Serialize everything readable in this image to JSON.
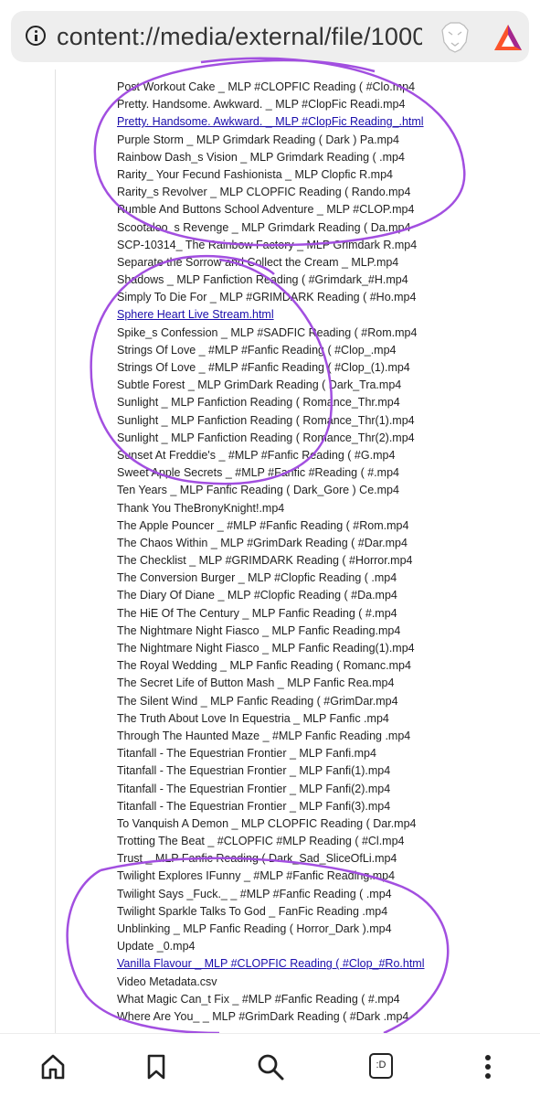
{
  "address_bar": {
    "url": "content://media/external/file/1000",
    "icons": [
      "info-icon",
      "brave-lion-icon",
      "brave-rewards-icon"
    ]
  },
  "colors": {
    "link": "#1a0dab",
    "annotation": "#a24fe0",
    "urlbar_bg": "#eeeeee",
    "brave_orange": "#fb542b"
  },
  "files": [
    {
      "name": "Post Workout Cake _ MLP #CLOPFIC Reading ( #Clo.mp4",
      "link": false
    },
    {
      "name": "Pretty. Handsome. Awkward. _ MLP #ClopFic Readi.mp4",
      "link": false
    },
    {
      "name": "Pretty. Handsome. Awkward. _ MLP #ClopFic Reading_.html",
      "link": true
    },
    {
      "name": "Purple Storm _ MLP Grimdark Reading ( Dark ) Pa.mp4",
      "link": false
    },
    {
      "name": "Rainbow Dash_s Vision _ MLP Grimdark Reading ( .mp4",
      "link": false
    },
    {
      "name": "Rarity_ Your Fecund Fashionista _ MLP Clopfic R.mp4",
      "link": false
    },
    {
      "name": "Rarity_s Revolver _ MLP CLOPFIC Reading ( Rando.mp4",
      "link": false
    },
    {
      "name": "Rumble And Buttons School Adventure _ MLP #CLOP.mp4",
      "link": false
    },
    {
      "name": "Scootaloo_s Revenge _ MLP Grimdark Reading ( Da.mp4",
      "link": false
    },
    {
      "name": "SCP-10314_ The Rainbow Factory _ MLP Grimdark R.mp4",
      "link": false
    },
    {
      "name": "Separate the Sorrow and Collect the Cream _ MLP.mp4",
      "link": false
    },
    {
      "name": "Shadows _ MLP Fanfiction Reading ( #Grimdark_#H.mp4",
      "link": false
    },
    {
      "name": "Simply To Die For _ MLP #GRIMDARK Reading ( #Ho.mp4",
      "link": false
    },
    {
      "name": "Sphere Heart Live Stream.html",
      "link": true
    },
    {
      "name": "Spike_s Confession _ MLP #SADFIC Reading ( #Rom.mp4",
      "link": false
    },
    {
      "name": "Strings Of Love _ #MLP #Fanfic Reading ( #Clop_.mp4",
      "link": false
    },
    {
      "name": "Strings Of Love _ #MLP #Fanfic Reading ( #Clop_(1).mp4",
      "link": false
    },
    {
      "name": "Subtle Forest _ MLP GrimDark Reading ( Dark_Tra.mp4",
      "link": false
    },
    {
      "name": "Sunlight _ MLP Fanfiction Reading ( Romance_Thr.mp4",
      "link": false
    },
    {
      "name": "Sunlight _ MLP Fanfiction Reading ( Romance_Thr(1).mp4",
      "link": false
    },
    {
      "name": "Sunlight _ MLP Fanfiction Reading ( Romance_Thr(2).mp4",
      "link": false
    },
    {
      "name": "Sunset At Freddie's _ #MLP #Fanfic Reading ( #G.mp4",
      "link": false
    },
    {
      "name": "Sweet Apple Secrets _ #MLP #Fanfic #Reading ( #.mp4",
      "link": false
    },
    {
      "name": "Ten Years _ MLP Fanfic Reading ( Dark_Gore ) Ce.mp4",
      "link": false
    },
    {
      "name": "Thank You TheBronyKnight!.mp4",
      "link": false
    },
    {
      "name": "The Apple Pouncer _ #MLP #Fanfic Reading ( #Rom.mp4",
      "link": false
    },
    {
      "name": "The Chaos Within _ MLP #GrimDark Reading ( #Dar.mp4",
      "link": false
    },
    {
      "name": "The Checklist _ MLP #GRIMDARK Reading ( #Horror.mp4",
      "link": false
    },
    {
      "name": "The Conversion Burger _ MLP #Clopfic Reading ( .mp4",
      "link": false
    },
    {
      "name": "The Diary Of Diane _ MLP #Clopfic Reading ( #Da.mp4",
      "link": false
    },
    {
      "name": "The HiE Of The Century _ MLP Fanfic Reading ( #.mp4",
      "link": false
    },
    {
      "name": "The Nightmare Night Fiasco _ MLP Fanfic Reading.mp4",
      "link": false
    },
    {
      "name": "The Nightmare Night Fiasco _ MLP Fanfic Reading(1).mp4",
      "link": false
    },
    {
      "name": "The Royal Wedding _ MLP Fanfic Reading ( Romanc.mp4",
      "link": false
    },
    {
      "name": "The Secret Life of Button Mash _ MLP Fanfic Rea.mp4",
      "link": false
    },
    {
      "name": "The Silent Wind _ MLP Fanfic Reading ( #GrimDar.mp4",
      "link": false
    },
    {
      "name": "The Truth About Love In Equestria _ MLP Fanfic .mp4",
      "link": false
    },
    {
      "name": "Through The Haunted Maze _ #MLP Fanfic Reading .mp4",
      "link": false
    },
    {
      "name": "Titanfall - The Equestrian Frontier _ MLP Fanfi.mp4",
      "link": false
    },
    {
      "name": "Titanfall - The Equestrian Frontier _ MLP Fanfi(1).mp4",
      "link": false
    },
    {
      "name": "Titanfall - The Equestrian Frontier _ MLP Fanfi(2).mp4",
      "link": false
    },
    {
      "name": "Titanfall - The Equestrian Frontier _ MLP Fanfi(3).mp4",
      "link": false
    },
    {
      "name": "To Vanquish A Demon _ MLP CLOPFIC Reading ( Dar.mp4",
      "link": false
    },
    {
      "name": "Trotting The Beat _ #CLOPFIC #MLP Reading ( #Cl.mp4",
      "link": false
    },
    {
      "name": "Trust _ MLP Fanfic Reading ( Dark_Sad_SliceOfLi.mp4",
      "link": false
    },
    {
      "name": "Twilight Explores IFunny _ #MLP #Fanfic Reading.mp4",
      "link": false
    },
    {
      "name": "Twilight Says _Fuck._ _ #MLP #Fanfic Reading ( .mp4",
      "link": false
    },
    {
      "name": "Twilight Sparkle Talks To God _ FanFic Reading .mp4",
      "link": false
    },
    {
      "name": "Unblinking _ MLP Fanfic Reading ( Horror_Dark ).mp4",
      "link": false
    },
    {
      "name": "Update _0.mp4",
      "link": false
    },
    {
      "name": "Vanilla Flavour _ MLP #CLOPFIC Reading ( #Clop_#Ro.html",
      "link": true
    },
    {
      "name": "Video Metadata.csv",
      "link": false
    },
    {
      "name": "What Magic Can_t Fix _ #MLP #Fanfic Reading ( #.mp4",
      "link": false
    },
    {
      "name": "Where Are You_ _ MLP #GrimDark Reading ( #Dark .mp4",
      "link": false
    }
  ],
  "bottom_nav": {
    "items": [
      "home-icon",
      "bookmark-icon",
      "search-icon",
      "tabs-icon",
      "menu-icon"
    ],
    "tab_count_label": ":D"
  }
}
